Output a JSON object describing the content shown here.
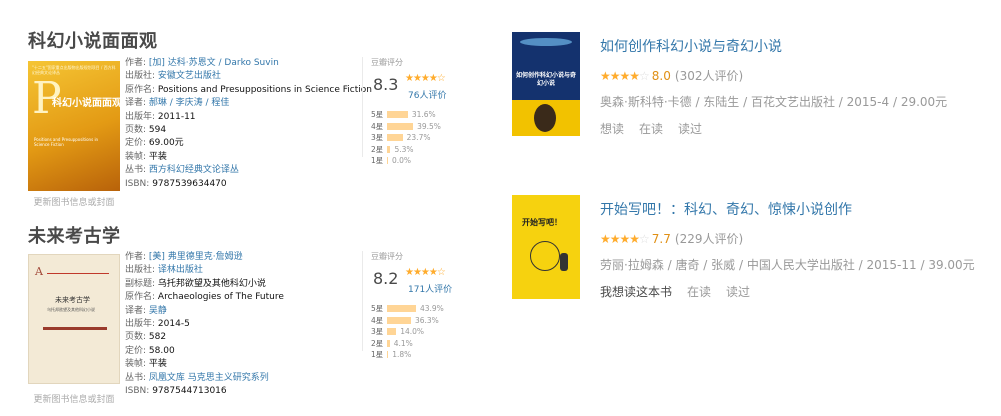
{
  "book1": {
    "title": "科幻小说面面观",
    "cover_top": "\"十二五\"国家重点出版物出版规划项目 / 西方科幻经典文论译丛",
    "cover_title": "科幻小说面面观",
    "cover_sub": "Positions and Presuppositions in Science Fiction",
    "cover_link": "更新图书信息或封面",
    "rows": [
      {
        "label": "作者:",
        "value": "[加] 达科·苏恩文 / Darko Suvin",
        "link": true
      },
      {
        "label": "出版社:",
        "value": "安徽文艺出版社",
        "link": true
      },
      {
        "label": "原作名:",
        "value": "Positions and Presuppositions in Science Fiction",
        "link": false
      },
      {
        "label": "译者:",
        "value": "郝琳 / 李庆涛 / 程佳",
        "link": true
      },
      {
        "label": "出版年:",
        "value": "2011-11",
        "link": false
      },
      {
        "label": "页数:",
        "value": "594",
        "link": false
      },
      {
        "label": "定价:",
        "value": "69.00元",
        "link": false
      },
      {
        "label": "装帧:",
        "value": "平装",
        "link": false
      },
      {
        "label": "丛书:",
        "value": "西方科幻经典文论译丛",
        "link": true
      },
      {
        "label": "ISBN:",
        "value": "9787539634470",
        "link": false
      }
    ],
    "rating_label": "豆瓣评分",
    "score": "8.3",
    "stars": "★★★★☆",
    "rating_count": "76人评价",
    "dist": [
      {
        "label": "5星",
        "pct": "31.6%",
        "value": 31.6
      },
      {
        "label": "4星",
        "pct": "39.5%",
        "value": 39.5
      },
      {
        "label": "3星",
        "pct": "23.7%",
        "value": 23.7
      },
      {
        "label": "2星",
        "pct": "5.3%",
        "value": 5.3
      },
      {
        "label": "1星",
        "pct": "0.0%",
        "value": 0.0
      }
    ]
  },
  "book2": {
    "title": "未来考古学",
    "cover_title": "未来考古学",
    "cover_sub": "乌托邦欲望及其他科幻小说",
    "cover_link": "更新图书信息或封面",
    "rows": [
      {
        "label": "作者:",
        "value": "[美] 弗里德里克·詹姆逊",
        "link": true
      },
      {
        "label": "出版社:",
        "value": "译林出版社",
        "link": true
      },
      {
        "label": "副标题:",
        "value": "乌托邦欲望及其他科幻小说",
        "link": false
      },
      {
        "label": "原作名:",
        "value": "Archaeologies of The Future",
        "link": false
      },
      {
        "label": "译者:",
        "value": "吴静",
        "link": true
      },
      {
        "label": "出版年:",
        "value": "2014-5",
        "link": false
      },
      {
        "label": "页数:",
        "value": "582",
        "link": false
      },
      {
        "label": "定价:",
        "value": "58.00",
        "link": false
      },
      {
        "label": "装帧:",
        "value": "平装",
        "link": false
      },
      {
        "label": "丛书:",
        "value": "凤凰文库 马克思主义研究系列",
        "link": true
      },
      {
        "label": "ISBN:",
        "value": "9787544713016",
        "link": false
      }
    ],
    "rating_label": "豆瓣评分",
    "score": "8.2",
    "stars": "★★★★☆",
    "rating_count": "171人评价",
    "dist": [
      {
        "label": "5星",
        "pct": "43.9%",
        "value": 43.9
      },
      {
        "label": "4星",
        "pct": "36.3%",
        "value": 36.3
      },
      {
        "label": "3星",
        "pct": "14.0%",
        "value": 14.0
      },
      {
        "label": "2星",
        "pct": "4.1%",
        "value": 4.1
      },
      {
        "label": "1星",
        "pct": "1.8%",
        "value": 1.8
      }
    ]
  },
  "right1": {
    "title": "如何创作科幻小说与奇幻小说",
    "cover_text": "如何创作科幻小说与奇幻小说",
    "stars_on": "★★★★",
    "stars_off": "☆",
    "score": "8.0",
    "count": "(302人评价)",
    "pub": "奥森·斯科特·卡德 / 东陆生 / 百花文艺出版社 / 2015-4 / 29.00元",
    "actions": [
      "想读",
      "在读",
      "读过"
    ]
  },
  "right2": {
    "title": "开始写吧！：科幻、奇幻、惊悚小说创作",
    "cover_text": "开始写吧！",
    "stars_on": "★★★★",
    "stars_off": "☆",
    "score": "7.7",
    "count": "(229人评价)",
    "pub": "劳丽·拉姆森 / 唐奇 / 张威 / 中国人民大学出版社 / 2015-11 / 39.00元",
    "actions": [
      "我想读这本书",
      "在读",
      "读过"
    ]
  },
  "colors": {
    "link": "#3377aa",
    "star": "#ffac2d",
    "score": "#e09015",
    "bar": "#ffd596"
  }
}
